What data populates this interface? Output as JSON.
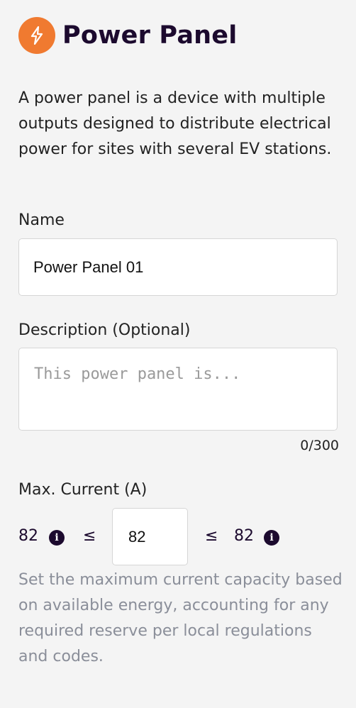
{
  "header": {
    "title": "Power Panel",
    "icon": "lightning-bolt-icon",
    "icon_color": "#f07a30"
  },
  "intro": "A power panel is a device with multiple outputs designed to distribute electrical power for sites with several EV stations.",
  "name_field": {
    "label": "Name",
    "value": "Power Panel 01"
  },
  "description_field": {
    "label": "Description (Optional)",
    "placeholder": "This power panel is...",
    "counter": "0/300"
  },
  "max_current": {
    "label": "Max. Current (A)",
    "min": "82",
    "leq": "≤",
    "value": "82",
    "max": "82",
    "info_icon": "info-icon",
    "help": "Set the maximum current capacity based on available energy, accounting for any required reserve per local regulations and codes."
  }
}
